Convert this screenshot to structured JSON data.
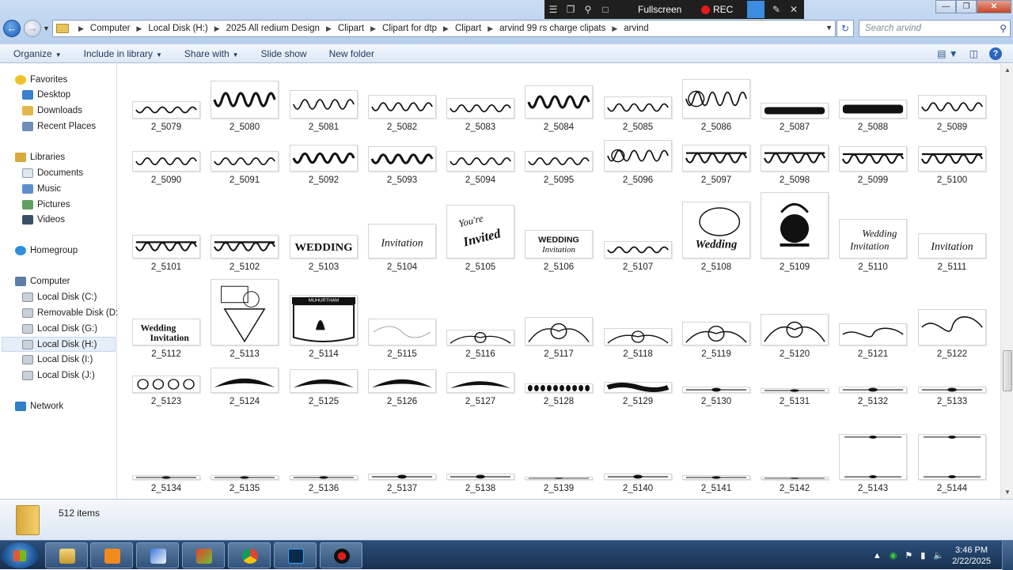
{
  "address": {
    "crumbs": [
      "Computer",
      "Local Disk (H:)",
      "2025  All redium  Design",
      "Clipart",
      "Clipart for dtp",
      "Clipart",
      "arvind 99 rs charge  clipats",
      "arvind"
    ],
    "search_placeholder": "Search arvind"
  },
  "recorder": {
    "fullscreen_label": "Fullscreen",
    "rec_label": "REC"
  },
  "toolbar": {
    "organize": "Organize",
    "include": "Include in library",
    "share": "Share with",
    "slideshow": "Slide show",
    "newfolder": "New folder"
  },
  "nav": {
    "favorites": "Favorites",
    "desktop": "Desktop",
    "downloads": "Downloads",
    "recent": "Recent Places",
    "libraries": "Libraries",
    "documents": "Documents",
    "music": "Music",
    "pictures": "Pictures",
    "videos": "Videos",
    "homegroup": "Homegroup",
    "computer": "Computer",
    "diskC": "Local Disk (C:)",
    "removableD": "Removable Disk (D:)",
    "diskG": "Local Disk (G:)",
    "diskH": "Local Disk (H:)",
    "diskI": "Local Disk (I:)",
    "diskJ": "Local Disk (J:)",
    "network": "Network"
  },
  "files": [
    "2_5079",
    "2_5080",
    "2_5081",
    "2_5082",
    "2_5083",
    "2_5084",
    "2_5085",
    "2_5086",
    "2_5087",
    "2_5088",
    "2_5089",
    "2_5090",
    "2_5091",
    "2_5092",
    "2_5093",
    "2_5094",
    "2_5095",
    "2_5096",
    "2_5097",
    "2_5098",
    "2_5099",
    "2_5100",
    "2_5101",
    "2_5102",
    "2_5103",
    "2_5104",
    "2_5105",
    "2_5106",
    "2_5107",
    "2_5108",
    "2_5109",
    "2_5110",
    "2_5111",
    "2_5112",
    "2_5113",
    "2_5114",
    "2_5115",
    "2_5116",
    "2_5117",
    "2_5118",
    "2_5119",
    "2_5120",
    "2_5121",
    "2_5122",
    "2_5123",
    "2_5124",
    "2_5125",
    "2_5126",
    "2_5127",
    "2_5128",
    "2_5129",
    "2_5130",
    "2_5131",
    "2_5132",
    "2_5133",
    "2_5134",
    "2_5135",
    "2_5136",
    "2_5137",
    "2_5138",
    "2_5139",
    "2_5140",
    "2_5141",
    "2_5142",
    "2_5143",
    "2_5144"
  ],
  "thumb_text": {
    "wedding": "WEDDING",
    "wedding_invitation": "WEDDING Invitation",
    "invitation": "Invitation",
    "youre_invited": "You're Invited",
    "muhurtham": "MUHURTHAM",
    "wedding_script": "Wedding",
    "wedding_invitation_script": "Wedding Invitation"
  },
  "status": {
    "item_count": "512 items"
  },
  "clock": {
    "time": "3:46 PM",
    "date": "2/22/2025"
  }
}
